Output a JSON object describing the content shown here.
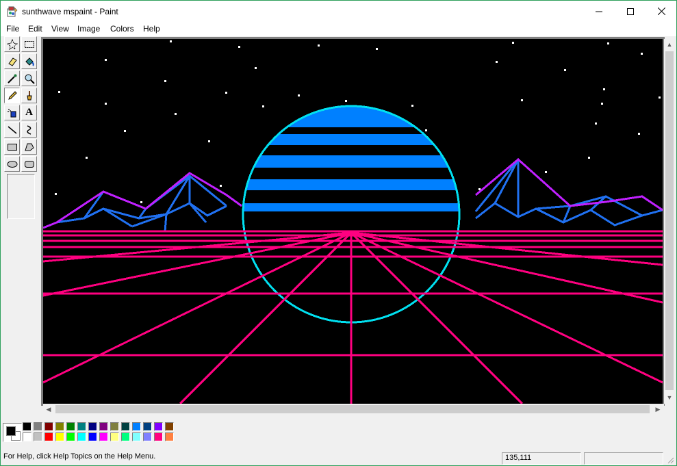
{
  "window": {
    "title": "sunthwave mspaint - Paint",
    "icon": "paint-icon",
    "controls": {
      "minimize": "minimize-icon",
      "maximize": "maximize-icon",
      "close": "close-icon"
    }
  },
  "menu": [
    "File",
    "Edit",
    "View",
    "Image",
    "Colors",
    "Help"
  ],
  "toolbox": {
    "tools": [
      {
        "name": "free-form-select",
        "icon": "free-form-select-icon",
        "active": false
      },
      {
        "name": "select",
        "icon": "rectangle-select-icon",
        "active": false
      },
      {
        "name": "eraser",
        "icon": "eraser-icon",
        "active": false
      },
      {
        "name": "fill",
        "icon": "fill-bucket-icon",
        "active": false
      },
      {
        "name": "pick-color",
        "icon": "eyedropper-icon",
        "active": false
      },
      {
        "name": "magnifier",
        "icon": "magnifier-icon",
        "active": false
      },
      {
        "name": "pencil",
        "icon": "pencil-icon",
        "active": true
      },
      {
        "name": "brush",
        "icon": "brush-icon",
        "active": false
      },
      {
        "name": "airbrush",
        "icon": "airbrush-icon",
        "active": false
      },
      {
        "name": "text",
        "icon": "text-icon",
        "label": "A",
        "active": false
      },
      {
        "name": "line",
        "icon": "line-icon",
        "active": false
      },
      {
        "name": "curve",
        "icon": "curve-icon",
        "active": false
      },
      {
        "name": "rectangle",
        "icon": "rectangle-icon",
        "active": false
      },
      {
        "name": "polygon",
        "icon": "polygon-icon",
        "active": false
      },
      {
        "name": "ellipse",
        "icon": "ellipse-icon",
        "active": false
      },
      {
        "name": "rounded-rectangle",
        "icon": "rounded-rectangle-icon",
        "active": false
      }
    ]
  },
  "colors": {
    "foreground": "#000000",
    "background": "#ffffff",
    "palette_top": [
      "#000000",
      "#808080",
      "#800000",
      "#808000",
      "#008000",
      "#008080",
      "#000080",
      "#800080",
      "#808040",
      "#004040",
      "#0080ff",
      "#004080",
      "#8000ff",
      "#804000"
    ],
    "palette_bottom": [
      "#ffffff",
      "#c0c0c0",
      "#ff0000",
      "#ffff00",
      "#00ff00",
      "#00ffff",
      "#0000ff",
      "#ff00ff",
      "#ffff80",
      "#00ff80",
      "#80ffff",
      "#8080ff",
      "#ff0080",
      "#ff8040"
    ],
    "canvas": {
      "sky": "#000000",
      "stars": "#ffffff",
      "sun_fill": "#0080ff",
      "sun_outline": "#00ffff",
      "grid": "#ff0080",
      "mountain_ridge": "#c020ff",
      "mountain_mesh": "#2070f0"
    }
  },
  "statusbar": {
    "help_text": "For Help, click Help Topics on the Help Menu.",
    "coordinates": "135,111",
    "selection_size": ""
  }
}
